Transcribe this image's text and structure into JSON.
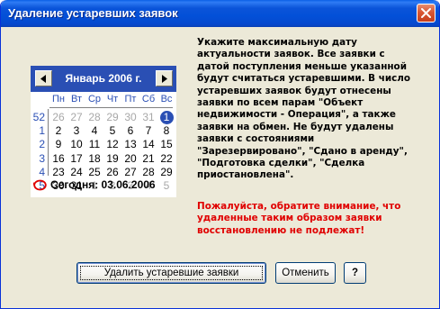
{
  "window": {
    "title": "Удаление устаревших заявок",
    "close_icon": "close-x-icon"
  },
  "calendar": {
    "month_label": "Январь 2006 г.",
    "prev_icon": "triangle-left-icon",
    "next_icon": "triangle-right-icon",
    "days_of_week": [
      "Пн",
      "Вт",
      "Ср",
      "Чт",
      "Пт",
      "Сб",
      "Вс"
    ],
    "weeks": [
      {
        "num": "52",
        "days": [
          {
            "d": "26",
            "other": true
          },
          {
            "d": "27",
            "other": true
          },
          {
            "d": "28",
            "other": true
          },
          {
            "d": "29",
            "other": true
          },
          {
            "d": "30",
            "other": true
          },
          {
            "d": "31",
            "other": true
          },
          {
            "d": "1",
            "selected": true
          }
        ]
      },
      {
        "num": "1",
        "days": [
          {
            "d": "2"
          },
          {
            "d": "3"
          },
          {
            "d": "4"
          },
          {
            "d": "5"
          },
          {
            "d": "6"
          },
          {
            "d": "7"
          },
          {
            "d": "8"
          }
        ]
      },
      {
        "num": "2",
        "days": [
          {
            "d": "9"
          },
          {
            "d": "10"
          },
          {
            "d": "11"
          },
          {
            "d": "12"
          },
          {
            "d": "13"
          },
          {
            "d": "14"
          },
          {
            "d": "15"
          }
        ]
      },
      {
        "num": "3",
        "days": [
          {
            "d": "16"
          },
          {
            "d": "17"
          },
          {
            "d": "18"
          },
          {
            "d": "19"
          },
          {
            "d": "20"
          },
          {
            "d": "21"
          },
          {
            "d": "22"
          }
        ]
      },
      {
        "num": "4",
        "days": [
          {
            "d": "23"
          },
          {
            "d": "24"
          },
          {
            "d": "25"
          },
          {
            "d": "26"
          },
          {
            "d": "27"
          },
          {
            "d": "28"
          },
          {
            "d": "29"
          }
        ]
      },
      {
        "num": "5",
        "days": [
          {
            "d": "30"
          },
          {
            "d": "31"
          },
          {
            "d": "1",
            "other": true
          },
          {
            "d": "2",
            "other": true
          },
          {
            "d": "3",
            "other": true
          },
          {
            "d": "4",
            "other": true
          },
          {
            "d": "5",
            "other": true
          }
        ]
      }
    ],
    "today_label": "Сегодня: 03.06.2006",
    "today_icon": "today-circle-icon",
    "colors": {
      "header": "#2a4fb4",
      "selected": "#2a4fb4",
      "other_month": "#a8a8a8"
    }
  },
  "info": {
    "lines": [
      "Укажите максимальную дату",
      "актуальности заявок. Все заявки с",
      "датой поступления меньше указанной",
      "будут считаться устаревшими. В число",
      "устаревших заявок будут отнесены",
      "заявки по всем парам \"Объект",
      "недвижимости - Операция\", а также",
      "заявки на обмен. Не будут удалены",
      "заявки с состояниями",
      "\"Зарезервировано\", \"Сдано в аренду\",",
      "\"Подготовка сделки\", \"Сделка",
      "приостановлена\"."
    ],
    "warning_lines": [
      "Пожалуйста, обратите внимание, что",
      "удаленные таким образом заявки",
      "восстановлению не подлежат!"
    ],
    "warning_color": "#e00000"
  },
  "buttons": {
    "delete_label": "Удалить устаревшие заявки",
    "cancel_label": "Отменить",
    "help_label": "?"
  }
}
